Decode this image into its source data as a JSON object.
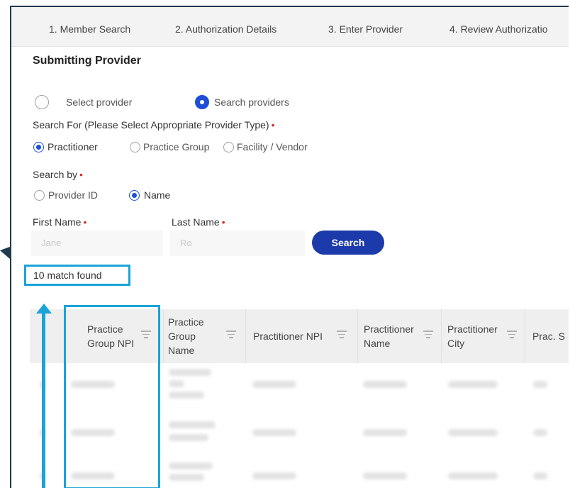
{
  "steps": [
    {
      "label": "1. Member Search"
    },
    {
      "label": "2. Authorization Details"
    },
    {
      "label": "3. Enter Provider"
    },
    {
      "label": "4. Review Authorizatio"
    }
  ],
  "section_title": "Submitting Provider",
  "provider_mode": {
    "options": [
      "Select provider",
      "Search providers"
    ],
    "selected": "Search providers"
  },
  "search_for": {
    "label": "Search For (Please Select Appropriate Provider Type)",
    "required_mark": "•",
    "options": [
      "Practitioner",
      "Practice Group",
      "Facility / Vendor"
    ],
    "selected": "Practitioner"
  },
  "search_by": {
    "label": "Search by",
    "required_mark": "•",
    "options": [
      "Provider ID",
      "Name"
    ],
    "selected": "Name"
  },
  "first_name": {
    "label": "First Name",
    "required_mark": "•",
    "value": "Jane"
  },
  "last_name": {
    "label": "Last Name",
    "required_mark": "•",
    "value": "Ro"
  },
  "search_button": "Search",
  "match_count": "10  match found",
  "table": {
    "columns": [
      "Practice Group NPI",
      "Practice Group Name",
      "Practitioner NPI",
      "Practitioner Name",
      "Practitioner City",
      "Prac. S"
    ]
  },
  "colors": {
    "accent": "#1c3aa9",
    "highlight": "#1aa3d6",
    "arrow": "#1e3a4c",
    "required": "#d32f2f"
  }
}
